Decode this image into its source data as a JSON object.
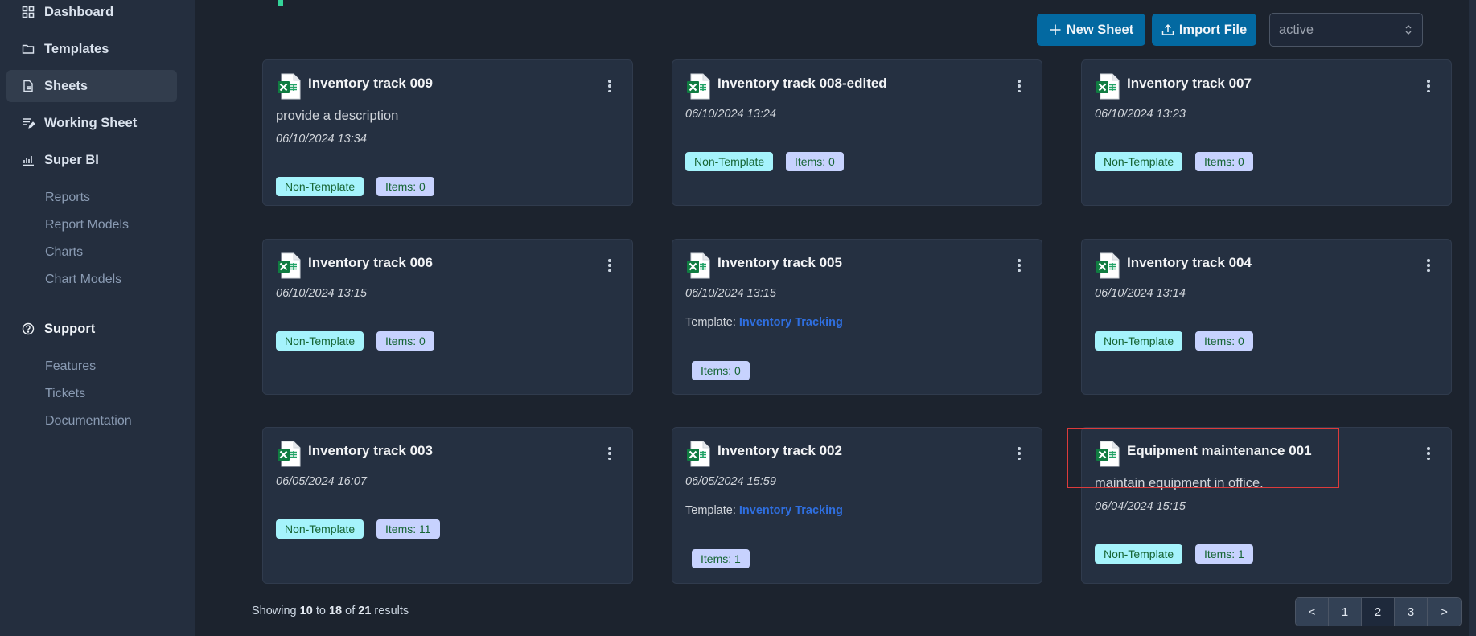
{
  "sidebar": {
    "nav": [
      {
        "label": "Dashboard",
        "icon": "grid-icon"
      },
      {
        "label": "Templates",
        "icon": "folder-icon"
      },
      {
        "label": "Sheets",
        "icon": "document-icon",
        "active": true
      },
      {
        "label": "Working Sheet",
        "icon": "list-edit-icon"
      },
      {
        "label": "Super BI",
        "icon": "bar-chart-icon"
      }
    ],
    "super_bi_items": [
      "Reports",
      "Report Models",
      "Charts",
      "Chart Models"
    ],
    "support": {
      "label": "Support",
      "icon": "help-circle-icon"
    },
    "support_items": [
      "Features",
      "Tickets",
      "Documentation"
    ]
  },
  "toolbar": {
    "new_sheet_label": "New Sheet",
    "import_file_label": "Import File",
    "status_filter": {
      "selected": "active"
    }
  },
  "cards": [
    {
      "title": "Inventory track 009",
      "description": "provide a description",
      "date": "06/10/2024 13:34",
      "template_label": null,
      "template_name": null,
      "type_badge": "Non-Template",
      "items_badge": "Items: 0"
    },
    {
      "title": "Inventory track 008-edited",
      "description": null,
      "date": "06/10/2024 13:24",
      "template_label": null,
      "template_name": null,
      "type_badge": "Non-Template",
      "items_badge": "Items: 0"
    },
    {
      "title": "Inventory track 007",
      "description": null,
      "date": "06/10/2024 13:23",
      "template_label": null,
      "template_name": null,
      "type_badge": "Non-Template",
      "items_badge": "Items: 0"
    },
    {
      "title": "Inventory track 006",
      "description": null,
      "date": "06/10/2024 13:15",
      "template_label": null,
      "template_name": null,
      "type_badge": "Non-Template",
      "items_badge": "Items: 0"
    },
    {
      "title": "Inventory track 005",
      "description": null,
      "date": "06/10/2024 13:15",
      "template_label": "Template:",
      "template_name": "Inventory Tracking",
      "type_badge": null,
      "items_badge": "Items: 0"
    },
    {
      "title": "Inventory track 004",
      "description": null,
      "date": "06/10/2024 13:14",
      "template_label": null,
      "template_name": null,
      "type_badge": "Non-Template",
      "items_badge": "Items: 0"
    },
    {
      "title": "Inventory track 003",
      "description": null,
      "date": "06/05/2024 16:07",
      "template_label": null,
      "template_name": null,
      "type_badge": "Non-Template",
      "items_badge": "Items: 11"
    },
    {
      "title": "Inventory track 002",
      "description": null,
      "date": "06/05/2024 15:59",
      "template_label": "Template:",
      "template_name": "Inventory Tracking",
      "type_badge": null,
      "items_badge": "Items: 1"
    },
    {
      "title": "Equipment maintenance 001",
      "description": "maintain equipment in office.",
      "date": "06/04/2024 15:15",
      "template_label": null,
      "template_name": null,
      "type_badge": "Non-Template",
      "items_badge": "Items: 1"
    }
  ],
  "footer": {
    "showing_prefix": "Showing",
    "from": "10",
    "to_word": "to",
    "to": "18",
    "of_word": "of",
    "total": "21",
    "suffix": "results"
  },
  "pagination": {
    "prev": "<",
    "pages": [
      "1",
      "2",
      "3"
    ],
    "current": "2",
    "next": ">"
  },
  "colors": {
    "primary_button": "#0369a1",
    "accent_green": "#34d399",
    "badge_non_template": "#a5f3fc",
    "badge_items": "#c7d2fe",
    "template_link": "#2f6fe0",
    "highlight_box": "#dc3b3b"
  }
}
